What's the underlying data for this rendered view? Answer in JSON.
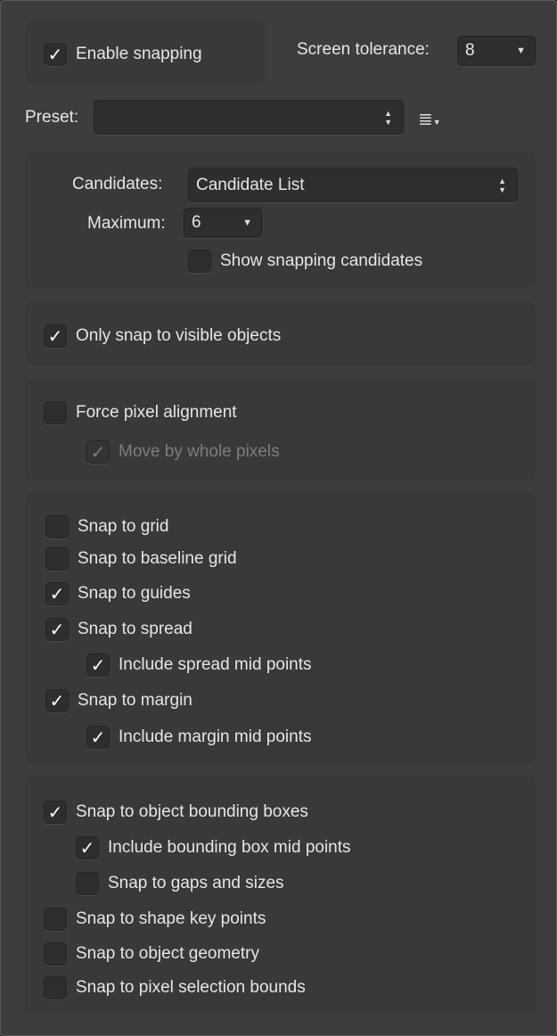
{
  "enable_snapping": {
    "label": "Enable snapping",
    "checked": true
  },
  "screen_tolerance": {
    "label": "Screen tolerance:",
    "value": "8"
  },
  "preset": {
    "label": "Preset:",
    "value": "",
    "menu_icon": "list-menu-icon"
  },
  "candidates": {
    "label": "Candidates:",
    "value": "Candidate List"
  },
  "maximum": {
    "label": "Maximum:",
    "value": "6"
  },
  "options": [
    {
      "label": "Show snapping candidates",
      "checked": false
    },
    {
      "label": "Only snap to visible objects",
      "checked": true
    },
    {
      "label": "Force pixel alignment",
      "checked": false
    },
    {
      "label": "Move by whole pixels",
      "checked": true,
      "disabled": true
    },
    {
      "label": "Snap to grid",
      "checked": false
    },
    {
      "label": "Snap to baseline grid",
      "checked": false
    },
    {
      "label": "Snap to guides",
      "checked": true
    },
    {
      "label": "Snap to spread",
      "checked": true
    },
    {
      "label": "Include spread mid points",
      "checked": true
    },
    {
      "label": "Snap to margin",
      "checked": true
    },
    {
      "label": "Include margin mid points",
      "checked": true
    },
    {
      "label": "Snap to object bounding boxes",
      "checked": true
    },
    {
      "label": "Include bounding box mid points",
      "checked": true
    },
    {
      "label": "Snap to gaps and sizes",
      "checked": false
    },
    {
      "label": "Snap to shape key points",
      "checked": false
    },
    {
      "label": "Snap to object geometry",
      "checked": false
    },
    {
      "label": "Snap to pixel selection bounds",
      "checked": false
    }
  ]
}
